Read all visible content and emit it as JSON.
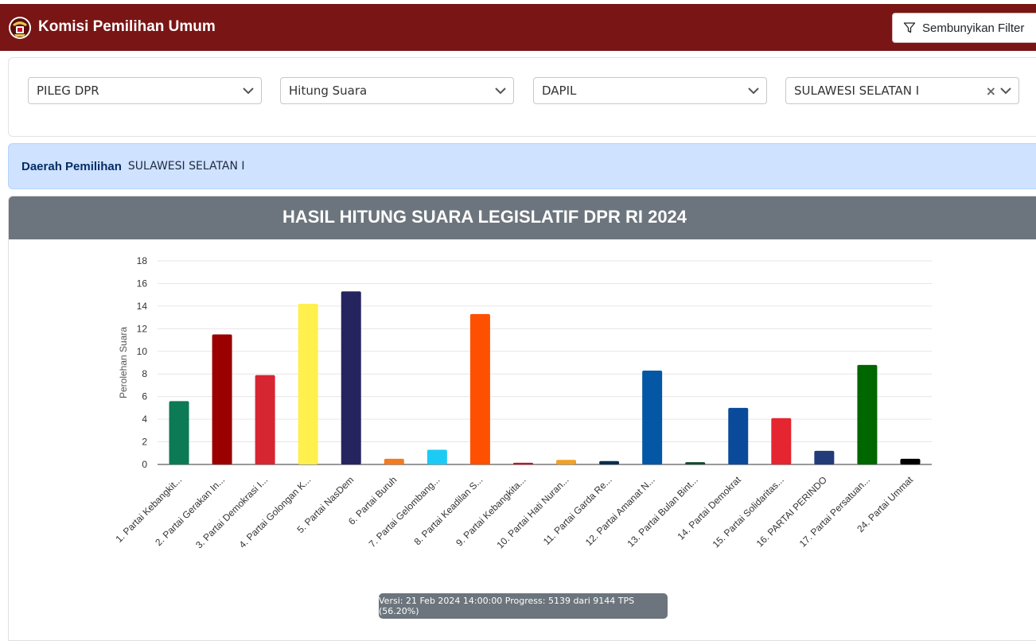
{
  "header": {
    "brand": "Komisi Pemilihan Umum",
    "filter_button_label": "Sembunyikan Filter",
    "logo_icon": "kpu-garuda-logo-icon",
    "filter_icon": "funnel-icon",
    "color": "#7a1515"
  },
  "filters": [
    {
      "value": "PILEG DPR"
    },
    {
      "value": "Hitung Suara"
    },
    {
      "value": "DAPIL"
    },
    {
      "value": "SULAWESI SELATAN I",
      "clearable": true
    }
  ],
  "info": {
    "label": "Daerah Pemilihan",
    "value": "SULAWESI SELATAN I"
  },
  "chart_title": "HASIL HITUNG SUARA LEGISLATIF DPR RI 2024",
  "chart_data": {
    "type": "bar",
    "title": "HASIL HITUNG SUARA LEGISLATIF DPR RI 2024",
    "ylabel": "Perolehan Suara",
    "xlabel": "",
    "ylim": [
      0,
      18
    ],
    "yticks": [
      0,
      2,
      4,
      6,
      8,
      10,
      12,
      14,
      16,
      18
    ],
    "grid": true,
    "legend": "none",
    "categories": [
      "1. Partai Kebangkit...",
      "2. Partai Gerakan In...",
      "3. Partai Demokrasi I...",
      "4. Partai Golongan K...",
      "5. Partai NasDem",
      "6. Partai Buruh",
      "7. Partai Gelombang...",
      "8. Partai Keadilan S...",
      "9. Partai Kebangkita...",
      "10. Partai Hati Nuran...",
      "11. Partai Garda Re...",
      "12. Partai Amanat N...",
      "13. Partai Bulan Bint...",
      "14. Partai Demokrat",
      "15. Partai Solidaritas...",
      "16. PARTAI PERINDO",
      "17. Partai Persatuan...",
      "24. Partai Ummat"
    ],
    "values": [
      5.6,
      11.5,
      7.9,
      14.2,
      15.3,
      0.5,
      1.3,
      13.3,
      0.15,
      0.4,
      0.3,
      8.3,
      0.2,
      5.0,
      4.1,
      1.2,
      8.8,
      0.5
    ],
    "colors": [
      "#0b7a55",
      "#9a0000",
      "#d62631",
      "#fff04d",
      "#26245e",
      "#f47a1f",
      "#1ccbf4",
      "#fe5000",
      "#c8102e",
      "#f0a127",
      "#0a2d4d",
      "#0457a5",
      "#114a2f",
      "#0a4a9b",
      "#e52530",
      "#243b7a",
      "#006600",
      "#000000"
    ]
  },
  "status": {
    "text": "Versi: 21 Feb 2024 14:00:00 Progress: 5139 dari 9144 TPS (56.20%)"
  }
}
